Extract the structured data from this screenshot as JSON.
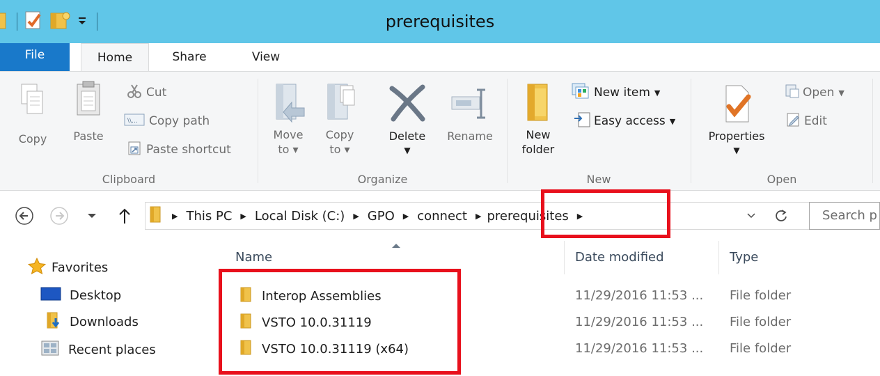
{
  "window": {
    "title": "prerequisites"
  },
  "ribbon_tabs": [
    {
      "label": "File"
    },
    {
      "label": "Home"
    },
    {
      "label": "Share"
    },
    {
      "label": "View"
    }
  ],
  "clipboard": {
    "copy": "Copy",
    "paste": "Paste",
    "cut": "Cut",
    "copy_path": "Copy path",
    "paste_shortcut": "Paste shortcut",
    "group_label": "Clipboard"
  },
  "organize": {
    "move_to_1": "Move",
    "move_to_2": "to",
    "copy_to_1": "Copy",
    "copy_to_2": "to",
    "delete": "Delete",
    "rename": "Rename",
    "group_label": "Organize"
  },
  "new_group": {
    "new_folder_1": "New",
    "new_folder_2": "folder",
    "new_item": "New item",
    "easy_access": "Easy access",
    "group_label": "New"
  },
  "open_group": {
    "properties": "Properties",
    "open": "Open",
    "edit": "Edit",
    "group_label": "Open"
  },
  "breadcrumb": [
    "This PC",
    "Local Disk (C:)",
    "GPO",
    "connect",
    "prerequisites"
  ],
  "search": {
    "placeholder": "Search p"
  },
  "nav_pane": {
    "favorites": "Favorites",
    "items": [
      "Desktop",
      "Downloads",
      "Recent places"
    ]
  },
  "file_list": {
    "columns": {
      "name": "Name",
      "date": "Date modified",
      "type": "Type"
    },
    "rows": [
      {
        "name": "Interop Assemblies",
        "date": "11/29/2016 11:53 ...",
        "type": "File folder"
      },
      {
        "name": "VSTO 10.0.31119",
        "date": "11/29/2016 11:53 ...",
        "type": "File folder"
      },
      {
        "name": "VSTO 10.0.31119 (x64)",
        "date": "11/29/2016 11:53 ...",
        "type": "File folder"
      }
    ]
  },
  "colors": {
    "titlebar": "#60c6e8",
    "file_tab": "#1979ca",
    "highlight": "#e8101c",
    "folder": "#f0c24a"
  },
  "icons": {
    "qat": [
      "folder-icon",
      "properties-icon",
      "new-folder-icon",
      "dropdown-icon"
    ],
    "clipboard": [
      "copy-icon",
      "paste-icon",
      "cut-icon",
      "copy-path-icon",
      "paste-shortcut-icon"
    ],
    "organize": [
      "move-to-icon",
      "copy-to-icon",
      "delete-icon",
      "rename-icon"
    ],
    "new": [
      "new-folder-icon",
      "new-item-icon",
      "easy-access-icon"
    ],
    "open": [
      "properties-icon",
      "open-icon",
      "edit-icon"
    ]
  }
}
